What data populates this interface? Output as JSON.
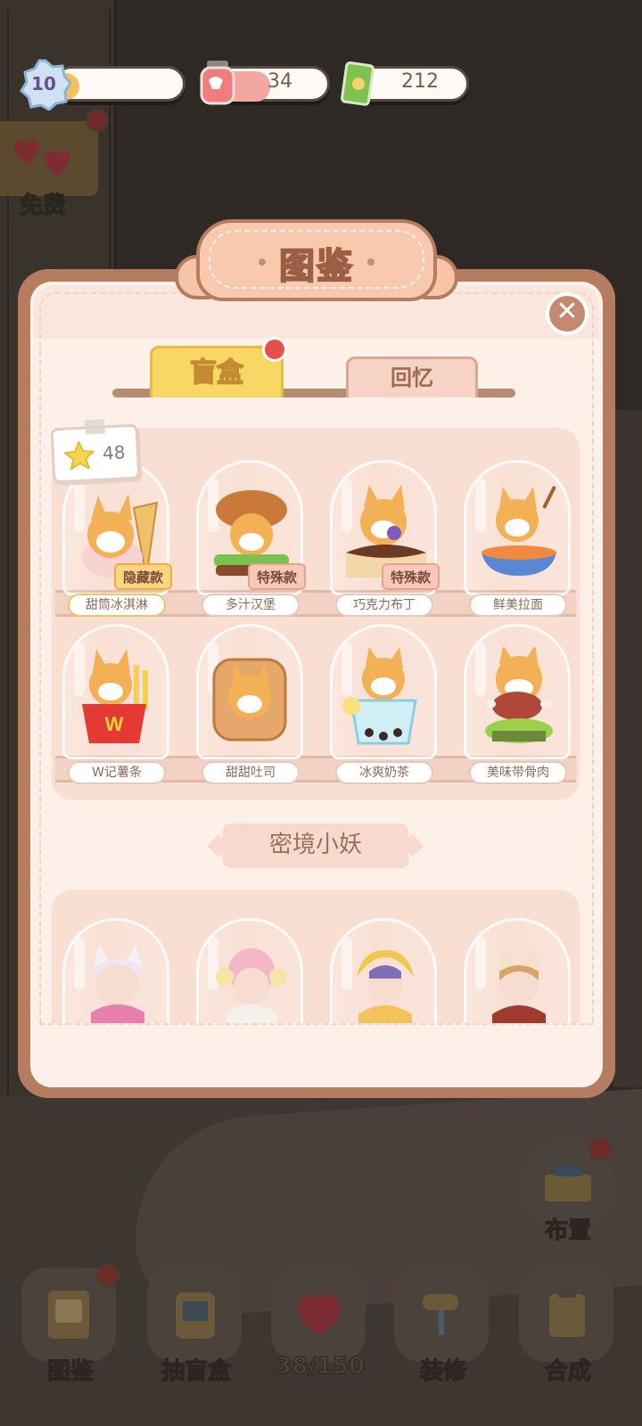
{
  "status": {
    "level": "10",
    "level_progress": 0.2,
    "energy": "34",
    "energy_progress": 0.45,
    "cash": "212"
  },
  "free_button": {
    "label": "免费"
  },
  "panel": {
    "title": "图鉴",
    "tabs": [
      {
        "label": "盲盒",
        "active": true
      },
      {
        "label": "回忆",
        "active": false
      }
    ],
    "star_count": "48",
    "blind_box_items": [
      {
        "name": "甜筒冰淇淋",
        "badge": "隐藏款",
        "badge_type": "hidden"
      },
      {
        "name": "多汁汉堡",
        "badge": "特殊款",
        "badge_type": "special"
      },
      {
        "name": "巧克力布丁",
        "badge": "特殊款",
        "badge_type": "special"
      },
      {
        "name": "鲜美拉面",
        "badge": "",
        "badge_type": ""
      },
      {
        "name": "W记薯条",
        "badge": "",
        "badge_type": ""
      },
      {
        "name": "甜甜吐司",
        "badge": "",
        "badge_type": ""
      },
      {
        "name": "冰爽奶茶",
        "badge": "",
        "badge_type": ""
      },
      {
        "name": "美味带骨肉",
        "badge": "",
        "badge_type": ""
      }
    ],
    "section_title": "密境小妖"
  },
  "arrange_button": {
    "label": "布置"
  },
  "bottom_nav": [
    {
      "label": "图鉴",
      "icon": "book-icon"
    },
    {
      "label": "抽盲盒",
      "icon": "gacha-machine-icon"
    },
    {
      "label": "38/150",
      "icon": "heart-icon"
    },
    {
      "label": "装修",
      "icon": "paint-roller-icon"
    },
    {
      "label": "合成",
      "icon": "clipboard-icon"
    }
  ],
  "colors": {
    "panel_border": "#b57c60",
    "panel_fill": "#fcf0e9",
    "tab_active": "#f8d765",
    "red_dot": "#ea4e4b"
  }
}
